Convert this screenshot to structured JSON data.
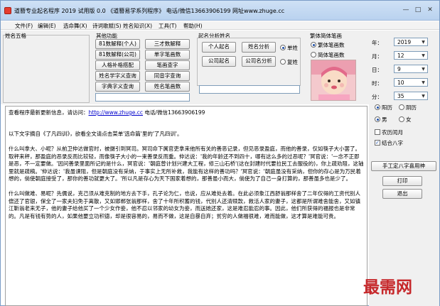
{
  "window": {
    "title": "道簪专业起名程序  2019 试用版 0.0   《道簪易学系列程序》 电话/微信13663906199 网址www.zhuge.cc",
    "min_glyph": "—",
    "max_glyph": "□",
    "close_glyph": "✕"
  },
  "menu": [
    "文件(F)",
    "编辑(E)",
    "选命舞(X)",
    "诗词歌赋(S)",
    "姓名知识(X)",
    "工具(T)",
    "帮助(H)"
  ],
  "groups": {
    "xingming": "姓名五格",
    "other": "其他功能",
    "name_analysis": "起名分析姓名",
    "fanjian": "繁体简体笔画"
  },
  "other_buttons": [
    "81数解释(个人)",
    "三才数解释",
    "81数解释(公司)",
    "单字笔画数",
    "人格补格搭配",
    "笔画查字",
    "姓名学字义查询",
    "同音字查询",
    "字典字义查询",
    "姓名笔画数"
  ],
  "name_buttons": [
    "个人起名",
    "姓名分析",
    "公司起名",
    "公司名分析"
  ],
  "name_radios": {
    "single": "单姓",
    "double": "复姓"
  },
  "fanjian_radios": {
    "fan": "繁体笔画数",
    "jian": "简体笔画数"
  },
  "date": {
    "labels": {
      "year": "年：",
      "month": "月：",
      "day": "日：",
      "hour": "时：",
      "minute": "分："
    },
    "values": {
      "year": "2019",
      "month": "12",
      "day": "9",
      "hour": "10",
      "minute": "35"
    },
    "calendar": {
      "solar": "阳历",
      "lunar": "阴历"
    },
    "gender": {
      "male": "男",
      "female": "女"
    },
    "leap": "农历闰月",
    "combine": "结合八字",
    "button_bazi": "手工定八字喜用神",
    "button_print": "打印",
    "button_exit": "退出"
  },
  "content": {
    "notice_prefix": "查看程序最新更新信息，请访问：",
    "notice_link": "http://www.zhuge.cc",
    "notice_suffix": " 电话/微信13663906199",
    "intro": "以下文字摘自《了凡四训》，欲看全文请点击菜单'选命篇'里的'了凡四训'。",
    "p1": "    什么叫拿大、小呢？从前卫仲达做官时，被摄引到冥司。冥司命下属官吏拿来他所有关的善恶记录，但见恶录盈庭，而他的善录，仅如筷子大小罢了。取秤来秤，那盈庭的恶录反而比较轻，而像筷子大小的一束善录反而重。仲达说：'我的年龄还不到四十，哪有这么多的过恶呢？'冥官说：'一念不正即是恶，不一定要做。'因问善录里面所记的是什么，冥官说：'朝庭曾计划兴建大工程，修三山石桥'(这在封建时代要拉民工去服役的)，你上疏劝阻，这轴里就是疏稿。'仲达说：'我虽谏阻，但是朝庭没有采纳，于事实上无所补救，我能有这样的善功吗？'冥官说：'朝庭虽没有采纳，但你的存心是为万民着想的，倘使朝庭接受了，那你的善功就更大了。'所以凡是存心为天下国家着想的，那善虽小而大，倘使为了自己一身打算的，那善虽多也是少了。",
    "p2": "    什么叫做难、易呢？先儒说，克己须从难克制的地方去下手，孔子论为仁，也说，应从难处去着。在此必须象江西舒翁那样舍了二年仅得的工资代别人偿还了官银，保全了一家夫妇免于离散，又如邯郸张翁那样，舍了十年所积蓄的钱，代别人还清赎款，救活人家的妻子，这都是所谓难舍能舍，又如镇江靳翁老来无子，他的妻子给他买了一个少女作妾，他不忍以邻家的幼女为妾，而送她还家，这是难忍能忍的事。因此，他们所获得的福报也是非常的。凡是有钱有势的人，如果他要立功积德，却是很容易的，易而不做，这是自暴自弃；贫穷的人做福很难，难而能做，这才算是难能可贵。"
  },
  "watermark": "最需网"
}
